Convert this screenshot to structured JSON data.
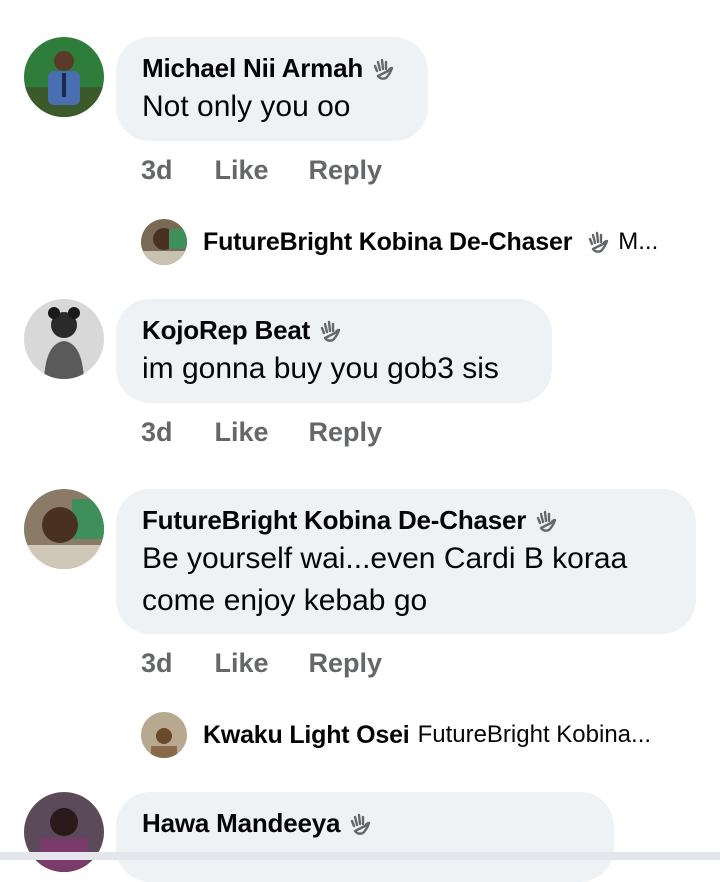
{
  "comments": [
    {
      "author": "Michael Nii Armah",
      "lines": [
        "Not only you oo"
      ],
      "age": "3d",
      "like": "Like",
      "reply": "Reply",
      "reply_preview": {
        "author": "FutureBright Kobina De-Chaser",
        "text": "M..."
      }
    },
    {
      "author": "KojoRep Beat",
      "lines": [
        "im gonna buy you gob3 sis"
      ],
      "age": "3d",
      "like": "Like",
      "reply": "Reply"
    },
    {
      "author": "FutureBright Kobina De-Chaser",
      "lines": [
        "Be yourself wai...even Cardi B koraa",
        "come enjoy kebab go"
      ],
      "age": "3d",
      "like": "Like",
      "reply": "Reply",
      "reply_preview": {
        "author": "Kwaku Light Osei",
        "text": "FutureBright Kobina..."
      }
    },
    {
      "author": "Hawa Mandeeya",
      "lines": []
    }
  ],
  "colors": {
    "bubble": "#eff2f5",
    "meta": "#65676b",
    "text": "#050505"
  },
  "icons": {
    "badge": "waving-hand-icon"
  }
}
